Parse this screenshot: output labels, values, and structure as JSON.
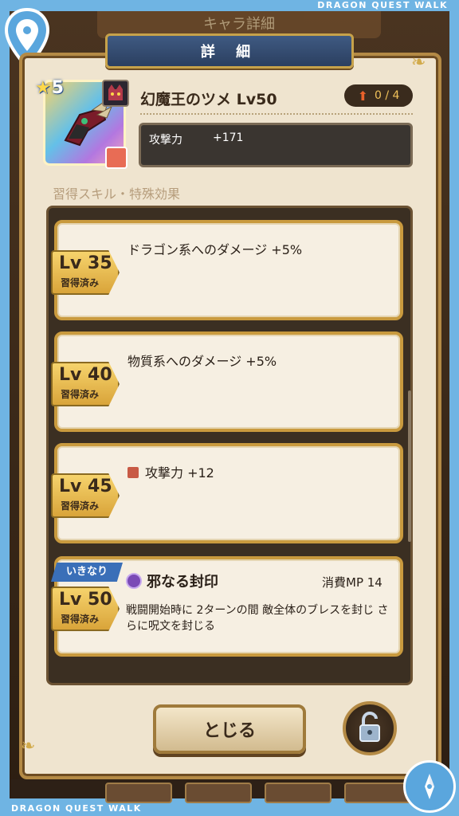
{
  "brand": {
    "top": "DRAGON QUEST WALK",
    "bottom": "DRAGON QUEST WALK"
  },
  "background": {
    "title": "キャラ詳細"
  },
  "header": {
    "title": "詳 細"
  },
  "item": {
    "rarity": "5",
    "name": "幻魔王のツメ Lv50",
    "upgrade": "0 / 4",
    "stat_label": "攻撃力",
    "stat_value": "+171"
  },
  "section_title": "習得スキル・特殊効果",
  "skills": [
    {
      "level": "Lv 35",
      "status": "習得済み",
      "text": "ドラゴン系へのダメージ +5%"
    },
    {
      "level": "Lv 40",
      "status": "習得済み",
      "text": "物質系へのダメージ +5%"
    },
    {
      "level": "Lv 45",
      "status": "習得済み",
      "text": "攻撃力 +12"
    },
    {
      "level": "Lv 50",
      "status": "習得済み",
      "tag": "いきなり",
      "title": "邪なる封印",
      "mp": "消費MP 14",
      "desc": "戦闘開始時に 2ターンの間 敵全体のブレスを封じ さらに呪文を封じる"
    }
  ],
  "buttons": {
    "close": "とじる"
  },
  "colors": {
    "frame": "#6fb4e3",
    "panel": "#efe4cf",
    "gold": "#c99a3e",
    "banner": "#2b3f60"
  },
  "icons": [
    "map-pin-icon",
    "compass-icon",
    "lock-icon",
    "star-icon",
    "attack-icon",
    "orb-icon",
    "claw-icon",
    "monster-icon",
    "upgrade-arrow-icon"
  ]
}
